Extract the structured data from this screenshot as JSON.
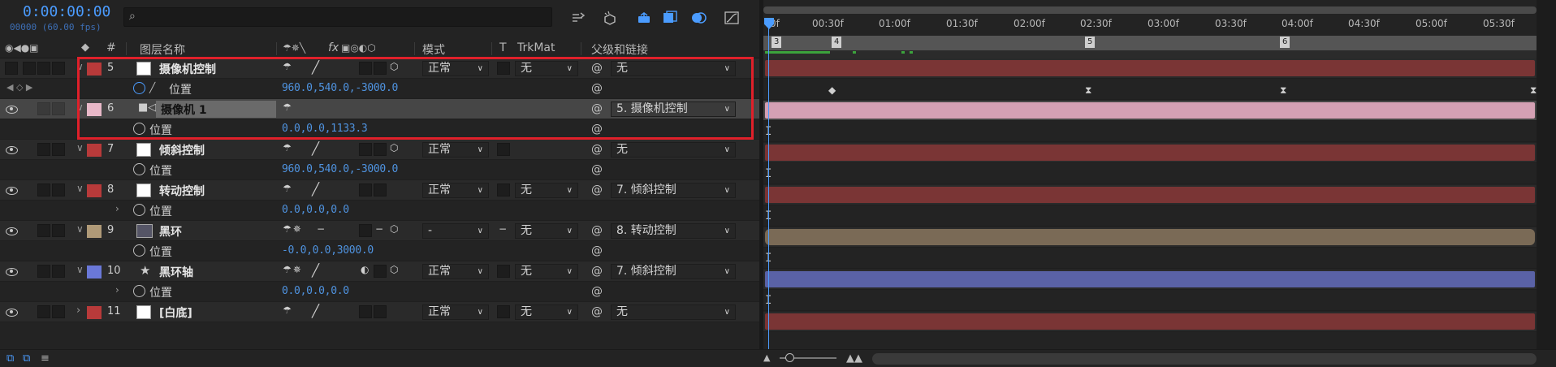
{
  "header": {
    "timecode": "0:00:00:00",
    "fps_info": "00000 (60.00 fps)",
    "search_placeholder": "",
    "toolbar_icons": [
      "composition-flowchart-icon",
      "draft-3d-icon",
      "shy-layers-icon",
      "frame-blending-icon",
      "motion-blur-icon",
      "graph-editor-icon"
    ]
  },
  "columns": {
    "hash": "#",
    "layer_name": "图层名称",
    "switches_fx": "fx",
    "mode": "模式",
    "t": "T",
    "trkmat": "TrkMat",
    "parent": "父级和链接"
  },
  "layers": [
    {
      "num": "5",
      "name": "摄像机控制",
      "label_color": "#b83a3a",
      "mode": "正常",
      "trkmat": "无",
      "parent": "无",
      "prop": {
        "name": "位置",
        "value": "960.0,540.0,-3000.0",
        "animated": true
      }
    },
    {
      "num": "6",
      "name": "摄像机 1",
      "label_color": "#e8b8c8",
      "parent": "5. 摄像机控制",
      "prop": {
        "name": "位置",
        "value": "0.0,0.0,1133.3"
      }
    },
    {
      "num": "7",
      "name": "倾斜控制",
      "label_color": "#b83a3a",
      "mode": "正常",
      "parent": "无",
      "prop": {
        "name": "位置",
        "value": "960.0,540.0,-3000.0"
      }
    },
    {
      "num": "8",
      "name": "转动控制",
      "label_color": "#b83a3a",
      "mode": "正常",
      "trkmat": "无",
      "parent": "7. 倾斜控制",
      "prop": {
        "name": "位置",
        "value": "0.0,0.0,0.0"
      }
    },
    {
      "num": "9",
      "name": "黑环",
      "label_color": "#b09a78",
      "mode": "-",
      "trkmat": "无",
      "parent": "8. 转动控制",
      "prop": {
        "name": "位置",
        "value": "-0.0,0.0,3000.0"
      }
    },
    {
      "num": "10",
      "name": "黑环轴",
      "label_color": "#6a78d8",
      "mode": "正常",
      "trkmat": "无",
      "parent": "7. 倾斜控制",
      "prop": {
        "name": "位置",
        "value": "0.0,0.0,0.0"
      }
    },
    {
      "num": "11",
      "name": "[白底]",
      "label_color": "#b83a3a",
      "mode": "正常",
      "trkmat": "无",
      "parent": "无"
    }
  ],
  "timeline": {
    "ruler_ticks": [
      "0f",
      "00:30f",
      "01:00f",
      "01:30f",
      "02:00f",
      "02:30f",
      "03:00f",
      "03:30f",
      "04:00f",
      "04:30f",
      "05:00f",
      "05:30f"
    ],
    "markers": [
      "3",
      "4",
      "5",
      "6"
    ],
    "bar_colors": {
      "red": "#7a3535",
      "pink": "#d4a0b4",
      "tan": "#7a6a56",
      "blue": "#5a62a6"
    }
  },
  "accent": "#4b9cff",
  "highlight_color": "#e0202a"
}
